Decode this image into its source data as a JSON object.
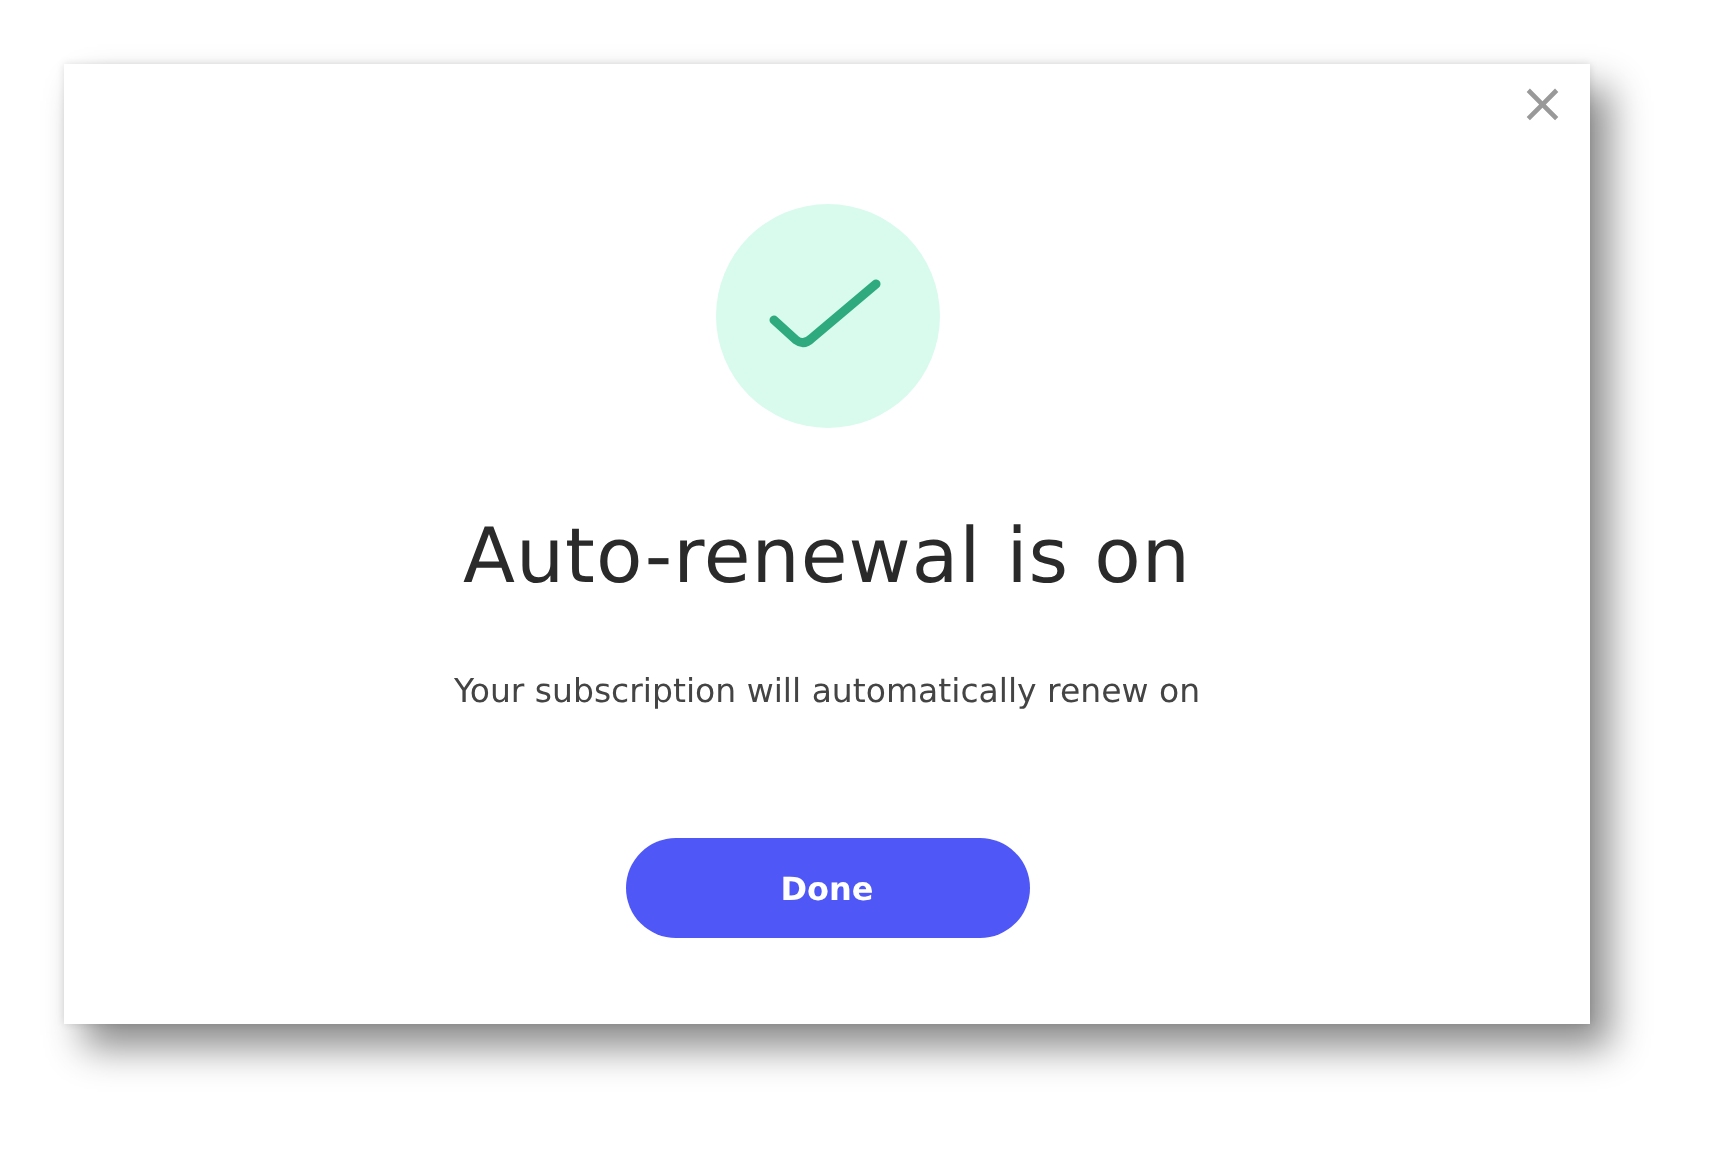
{
  "dialog": {
    "close_label": "×",
    "title": "Auto-renewal is on",
    "message": "Your subscription will automatically renew on",
    "button": "Done"
  }
}
